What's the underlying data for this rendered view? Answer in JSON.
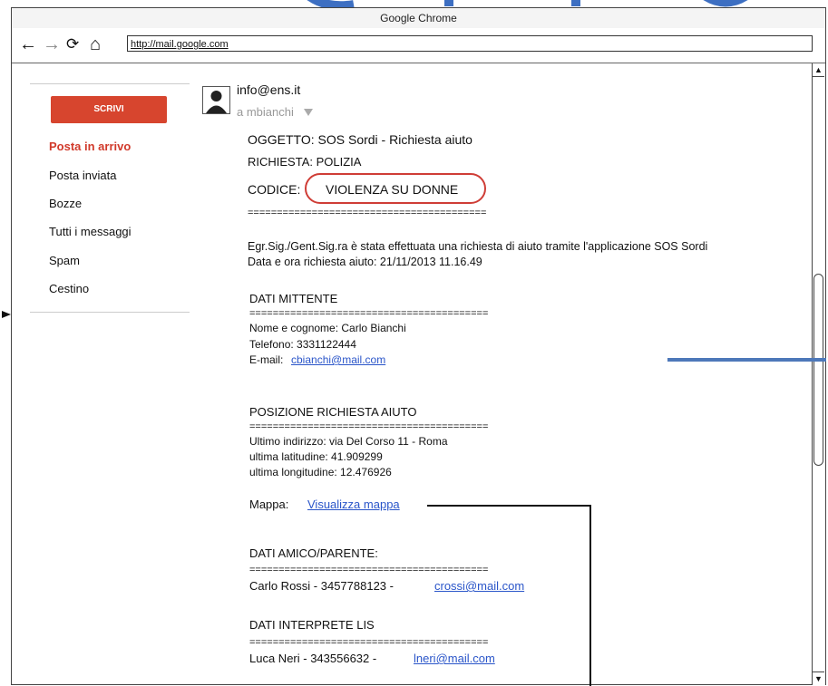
{
  "browser": {
    "title": "Google Chrome",
    "url": "http://mail.google.com",
    "back": "←",
    "forward": "→",
    "reload": "⟳",
    "home": "⌂"
  },
  "sidebar": {
    "compose": "SCRIVI",
    "items": [
      {
        "label": "Posta in arrivo",
        "active": true
      },
      {
        "label": "Posta inviata"
      },
      {
        "label": "Bozze"
      },
      {
        "label": "Tutti i messaggi"
      },
      {
        "label": "Spam"
      },
      {
        "label": "Cestino"
      }
    ]
  },
  "email": {
    "from": "info@ens.it",
    "to": "a mbianchi",
    "subject": "OGGETTO: SOS Sordi - Richiesta aiuto",
    "request": "RICHIESTA: POLIZIA",
    "code_label": "CODICE:",
    "code_value": "VIOLENZA SU DONNE",
    "rule": "=========================================",
    "intro": "Egr.Sig./Gent.Sig.ra è stata effettuata una richiesta di aiuto tramite l'applicazione SOS Sordi",
    "datetime": "Data e ora richiesta aiuto: 21/11/2013 11.16.49",
    "sender_title": "DATI MITTENTE",
    "sender_name": "Nome e cognome: Carlo Bianchi",
    "sender_phone": "Telefono: 3331122444",
    "sender_email_label": "E-mail:",
    "sender_email": "cbianchi@mail.com",
    "position_title": "POSIZIONE RICHIESTA AIUTO",
    "address": "Ultimo indirizzo: via Del Corso 11 - Roma",
    "latitude": "ultima latitudine: 41.909299",
    "longitude": "ultima longitudine: 12.476926",
    "map_label": "Mappa:",
    "map_link": "Visualizza mappa",
    "friend_title": "DATI AMICO/PARENTE:",
    "friend_text": "Carlo Rossi - 3457788123 -",
    "friend_email": "crossi@mail.com",
    "interpreter_title": "DATI INTERPRETE LIS",
    "interpreter_text": "Luca Neri - 343556632 -",
    "interpreter_email": "lneri@mail.com"
  },
  "colors": {
    "compose": "#d7452e",
    "active": "#d13a2b",
    "link": "#2a55c9",
    "highlight": "#cf3d36",
    "annotation": "#4d78b9"
  }
}
